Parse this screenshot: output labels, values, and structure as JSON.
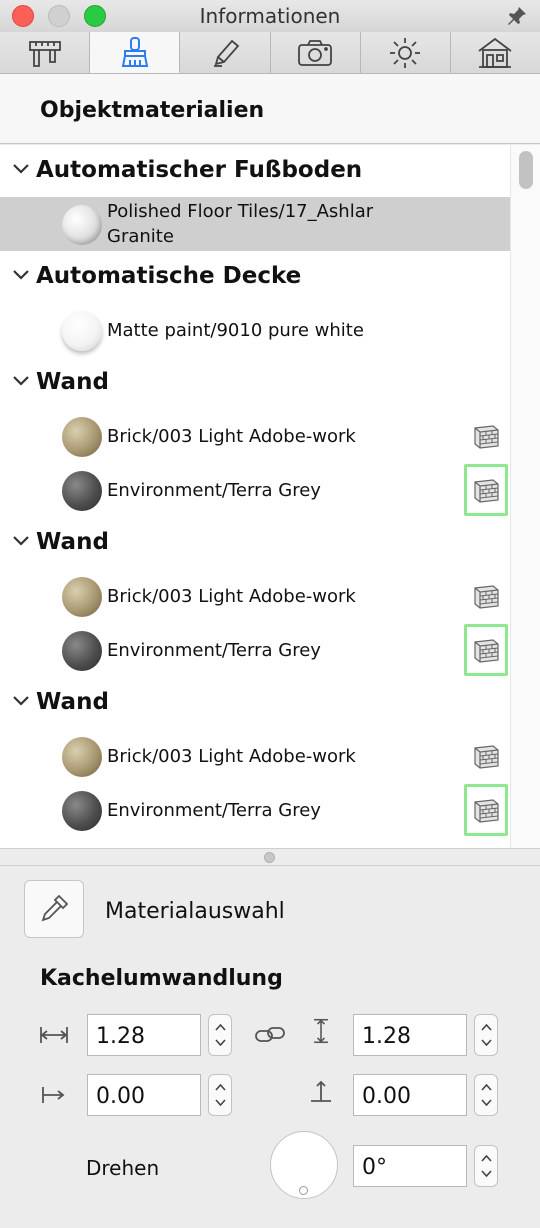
{
  "window": {
    "title": "Informationen"
  },
  "tabs": [
    {
      "icon": "caliper-ruler-icon",
      "active": false
    },
    {
      "icon": "paintbrush-icon",
      "active": true
    },
    {
      "icon": "pencil-icon",
      "active": false
    },
    {
      "icon": "camera-icon",
      "active": false
    },
    {
      "icon": "sun-icon",
      "active": false
    },
    {
      "icon": "house-icon",
      "active": false
    }
  ],
  "section": {
    "title": "Objektmaterialien"
  },
  "material_list": {
    "groups": [
      {
        "label": "Automatischer Fußboden",
        "items": [
          {
            "label": "Polished Floor Tiles/17_Ashlar Granite",
            "swatch": "granite",
            "selected": true,
            "tile_button": false
          }
        ]
      },
      {
        "label": "Automatische Decke",
        "items": [
          {
            "label": "Matte paint/9010 pure white",
            "swatch": "white",
            "selected": false,
            "tile_button": false
          }
        ]
      },
      {
        "label": "Wand",
        "items": [
          {
            "label": "Brick/003 Light Adobe-work",
            "swatch": "brick",
            "selected": false,
            "tile_button": true,
            "highlighted": false
          },
          {
            "label": "Environment/Terra Grey",
            "swatch": "grey",
            "selected": false,
            "tile_button": true,
            "highlighted": true
          }
        ]
      },
      {
        "label": "Wand",
        "items": [
          {
            "label": "Brick/003 Light Adobe-work",
            "swatch": "brick",
            "selected": false,
            "tile_button": true,
            "highlighted": false
          },
          {
            "label": "Environment/Terra Grey",
            "swatch": "grey",
            "selected": false,
            "tile_button": true,
            "highlighted": true
          }
        ]
      },
      {
        "label": "Wand",
        "items": [
          {
            "label": "Brick/003 Light Adobe-work",
            "swatch": "brick",
            "selected": false,
            "tile_button": true,
            "highlighted": false
          },
          {
            "label": "Environment/Terra Grey",
            "swatch": "grey",
            "selected": false,
            "tile_button": true,
            "highlighted": true
          }
        ]
      }
    ]
  },
  "material_picker": {
    "label": "Materialauswahl"
  },
  "tiling": {
    "title": "Kachelumwandlung",
    "width_value": "1.28",
    "height_value": "1.28",
    "offset_x_value": "0.00",
    "offset_y_value": "0.00",
    "rotate_label": "Drehen",
    "rotate_value": "0°"
  },
  "colors": {
    "highlight_border": "#8de88f",
    "selected_row": "#cfcfcf",
    "close": "#fc5f57",
    "maximize": "#2acb42"
  }
}
